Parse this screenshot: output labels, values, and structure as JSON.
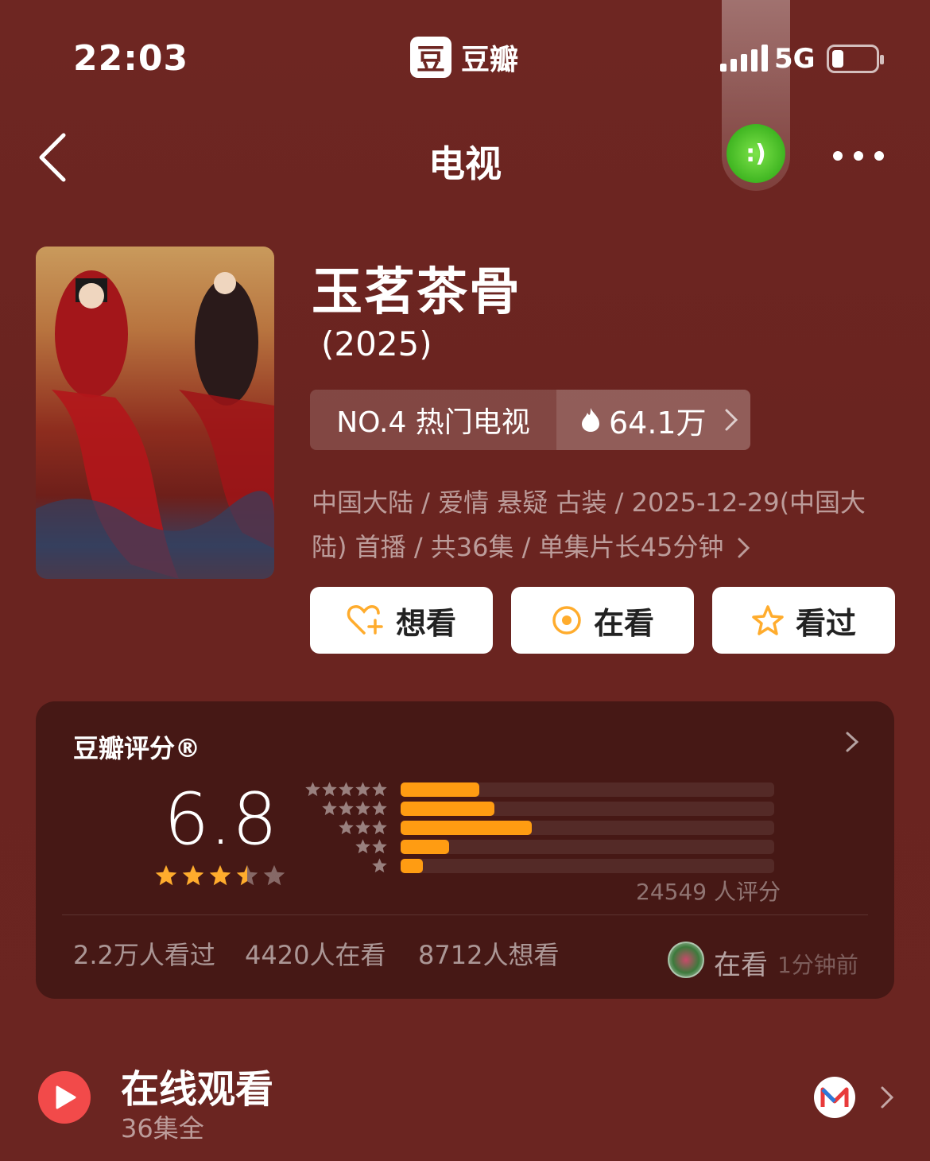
{
  "status_bar": {
    "time": "22:03",
    "network": "5G",
    "battery_level": 0.2
  },
  "app": {
    "logo_char": "豆",
    "name": "豆瓣"
  },
  "floating_widget": {
    "glyph": ":)"
  },
  "nav": {
    "title": "电视"
  },
  "show": {
    "title": "玉茗茶骨",
    "year": "(2025)",
    "rank_label": "NO.4 热门电视",
    "heat_value": "64.1万",
    "meta": "中国大陆 / 爱情 悬疑 古装 / 2025-12-29(中国大陆) 首播 / 共36集 / 单集片长45分钟"
  },
  "actions": {
    "want": "想看",
    "watching": "在看",
    "watched": "看过"
  },
  "rating": {
    "label": "豆瓣评分®",
    "score": "6.8",
    "stars": 3.5,
    "distribution": [
      {
        "stars": 5,
        "fraction": 0.21
      },
      {
        "stars": 4,
        "fraction": 0.25
      },
      {
        "stars": 3,
        "fraction": 0.35
      },
      {
        "stars": 2,
        "fraction": 0.13
      },
      {
        "stars": 1,
        "fraction": 0.06
      }
    ],
    "votes": "24549 人评分",
    "watched_count": "2.2万人看过",
    "watching_count": "4420人在看",
    "want_count": "8712人想看",
    "friend_status": "在看",
    "friend_time": "1分钟前"
  },
  "online": {
    "title": "在线观看",
    "subtitle": "36集全"
  },
  "colors": {
    "background": "#6e2622",
    "accent_orange": "#ff9c12",
    "star": "#ffac2d",
    "play": "#f24a4a"
  }
}
